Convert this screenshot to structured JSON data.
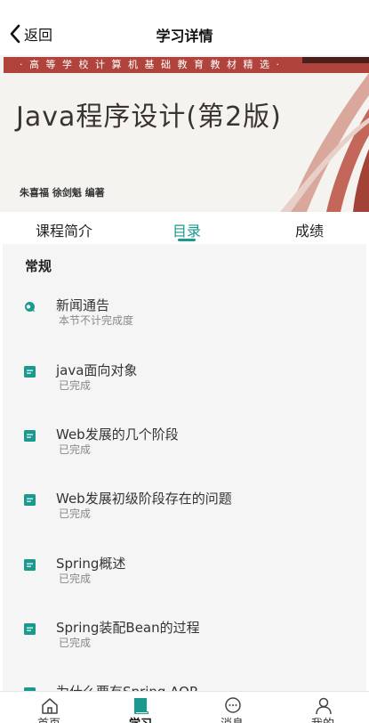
{
  "header": {
    "back_label": "返回",
    "title": "学习详情"
  },
  "cover": {
    "series": "· 高 等 学 校 计 算 机 基 础 教 育 教 材 精 选 ·",
    "title": "Java程序设计(第2版)",
    "authors": "朱喜福  徐剑魁  编著"
  },
  "tabs": [
    {
      "label": "课程简介"
    },
    {
      "label": "目录",
      "active": true
    },
    {
      "label": "成绩"
    }
  ],
  "section": {
    "title": "常规"
  },
  "items": [
    {
      "title": "新闻通告",
      "status": "本节不计完成度",
      "icon": "chat-icon"
    },
    {
      "title": "java面向对象",
      "status": "已完成",
      "icon": "document-icon"
    },
    {
      "title": "Web发展的几个阶段",
      "status": "已完成",
      "icon": "document-icon"
    },
    {
      "title": "Web发展初级阶段存在的问题",
      "status": "已完成",
      "icon": "document-icon"
    },
    {
      "title": "Spring概述",
      "status": "已完成",
      "icon": "document-icon"
    },
    {
      "title": "Spring装配Bean的过程",
      "status": "已完成",
      "icon": "document-icon"
    },
    {
      "title": "为什么要有Spring AOP",
      "status": "",
      "icon": "document-icon"
    }
  ],
  "bottom_nav": [
    {
      "label": "首页",
      "icon": "home-icon"
    },
    {
      "label": "学习",
      "icon": "book-icon",
      "active": true
    },
    {
      "label": "消息",
      "icon": "message-icon"
    },
    {
      "label": "我的",
      "icon": "user-icon"
    }
  ],
  "colors": {
    "accent": "#1a9a8f",
    "cover_band": "#b0443c"
  }
}
